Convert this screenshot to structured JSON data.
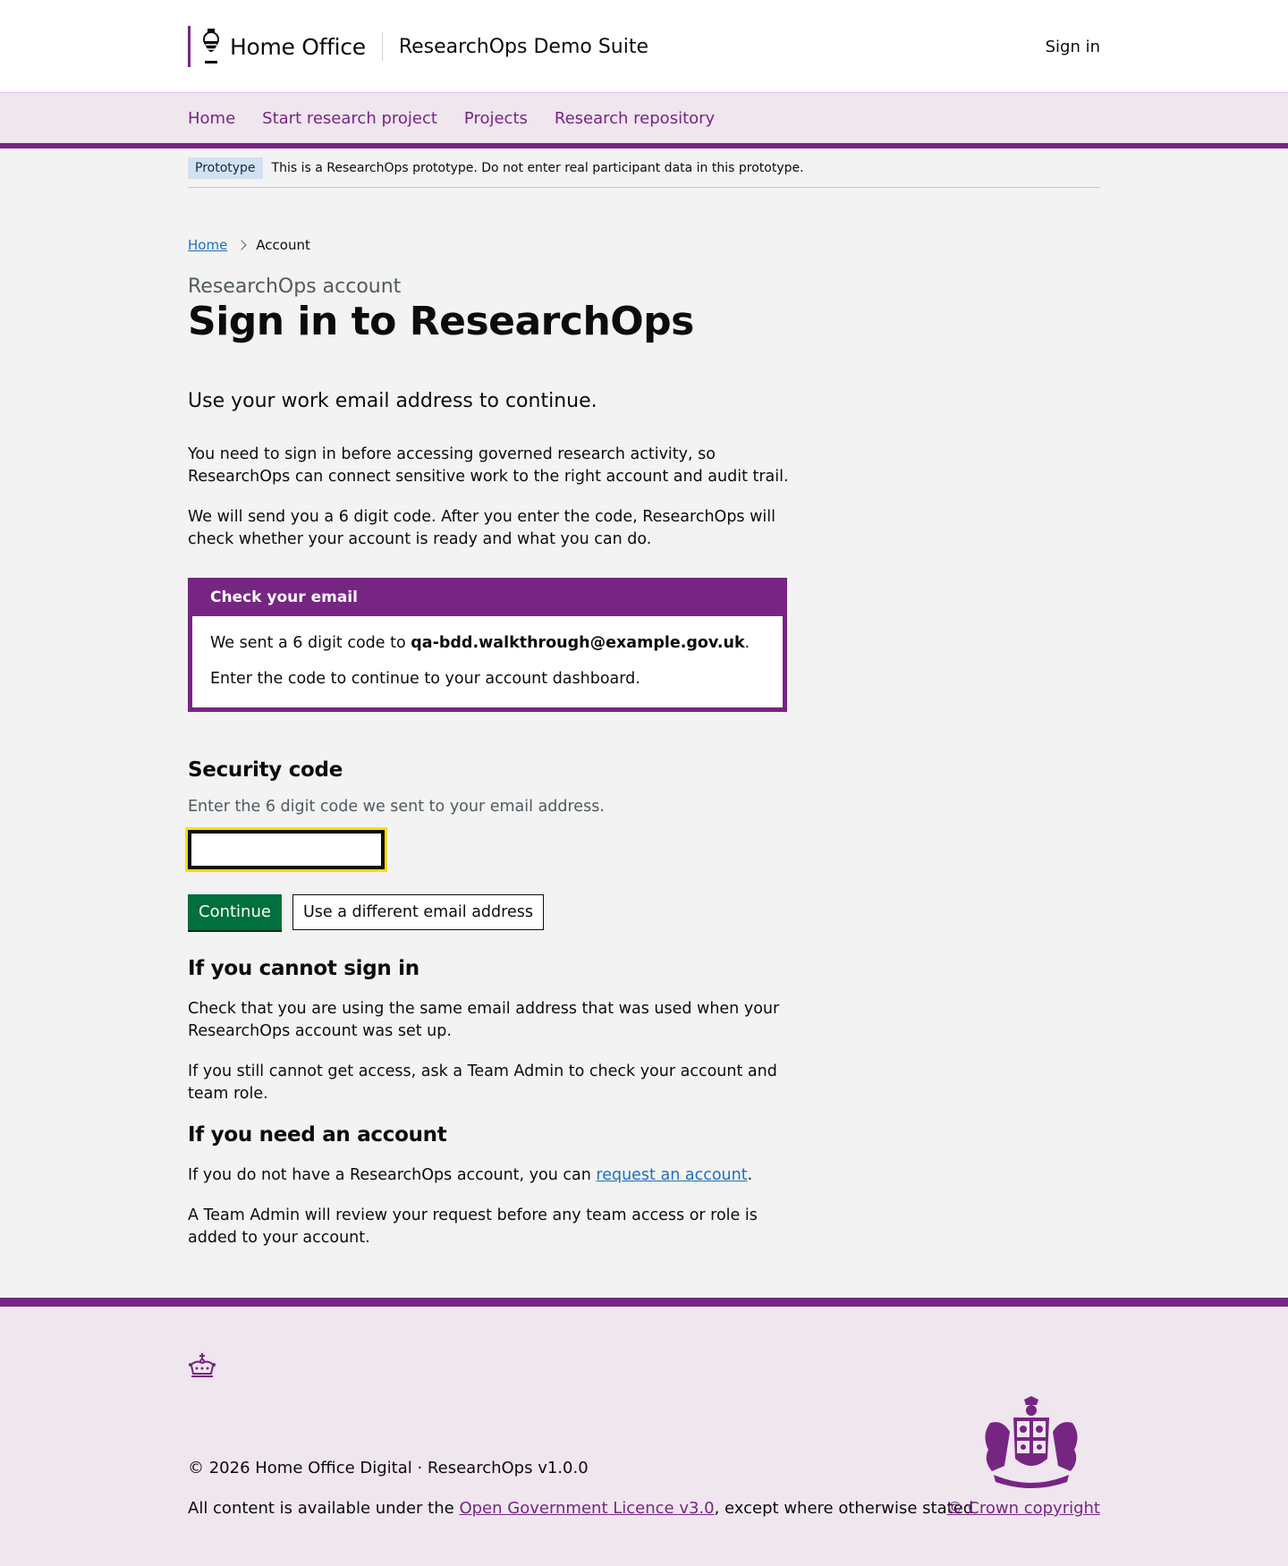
{
  "header": {
    "brand_name": "Home Office",
    "service_name": "ResearchOps Demo Suite",
    "sign_in": "Sign in"
  },
  "nav": {
    "items": [
      {
        "label": "Home"
      },
      {
        "label": "Start research project"
      },
      {
        "label": "Projects"
      },
      {
        "label": "Research repository"
      }
    ]
  },
  "phase_banner": {
    "tag": "Prototype",
    "text": "This is a ResearchOps prototype. Do not enter real participant data in this prototype."
  },
  "breadcrumb": {
    "home": "Home",
    "current": "Account"
  },
  "page": {
    "caption": "ResearchOps account",
    "title": "Sign in to ResearchOps",
    "lead": "Use your work email address to continue.",
    "para1": "You need to sign in before accessing governed research activity, so ResearchOps can connect sensitive work to the right account and audit trail.",
    "para2": "We will send you a 6 digit code. After you enter the code, ResearchOps will check whether your account is ready and what you can do."
  },
  "panel": {
    "title": "Check your email",
    "line1_prefix": "We sent a 6 digit code to ",
    "email": "qa-bdd.walkthrough@example.gov.uk",
    "line1_suffix": ".",
    "line2": "Enter the code to continue to your account dashboard."
  },
  "security": {
    "heading": "Security code",
    "hint": "Enter the 6 digit code we sent to your email address.",
    "value": ""
  },
  "buttons": {
    "continue": "Continue",
    "different_email": "Use a different email address"
  },
  "cannot_sign_in": {
    "heading": "If you cannot sign in",
    "para1": "Check that you are using the same email address that was used when your ResearchOps account was set up.",
    "para2": "If you still cannot get access, ask a Team Admin to check your account and team role."
  },
  "need_account": {
    "heading": "If you need an account",
    "para1_prefix": "If you do not have a ResearchOps account, you can ",
    "para1_link": "request an account",
    "para1_suffix": ".",
    "para2": "A Team Admin will review your request before any team access or role is added to your account."
  },
  "footer": {
    "copyright": "© 2026 Home Office Digital · ResearchOps v1.0.0",
    "licence_prefix": "All content is available under the ",
    "licence_link": "Open Government Licence v3.0",
    "licence_suffix": ", except where otherwise stated",
    "crown_copyright": "© Crown copyright"
  },
  "colors": {
    "brand_purple": "#772583",
    "nav_background": "#efe6ee",
    "button_green": "#00703c",
    "link_blue": "#1d70b8",
    "focus_yellow": "#ffdd00",
    "phase_tag_blue": "#d2e2f1"
  }
}
